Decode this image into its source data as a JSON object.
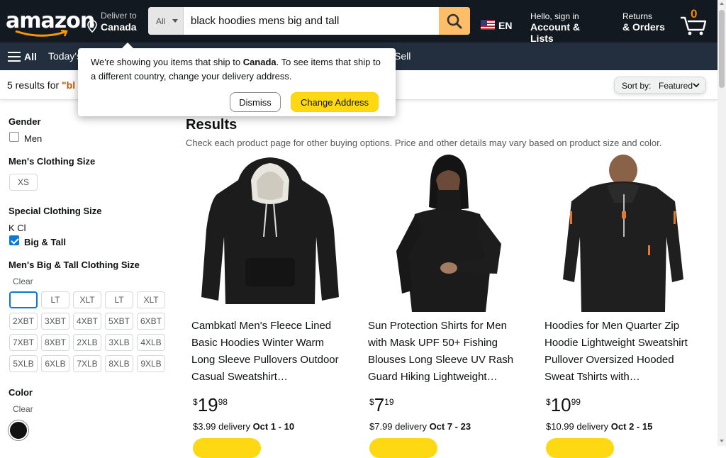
{
  "header": {
    "logo_text": "amazon",
    "deliver_line1": "Deliver to",
    "deliver_line2": "Canada",
    "search_dept": "All",
    "search_value": "black hoodies mens big and tall",
    "lang": "EN",
    "account_line1": "Hello, sign in",
    "account_line2": "Account & Lists",
    "orders_line1": "Returns",
    "orders_line2": "& Orders",
    "cart_count": "0"
  },
  "subnav": {
    "all_label": "All",
    "todays": "Today's",
    "sell": "Sell"
  },
  "popover": {
    "msg_before": "We're showing you items that ship to ",
    "msg_country": "Canada",
    "msg_after": ". To see items that ship to a different country, change your delivery address.",
    "dismiss": "Dismiss",
    "change": "Change Address"
  },
  "results_bar": {
    "count_text": "5 results for ",
    "query_text": "\"bl",
    "sort_label": "Sort by:",
    "sort_value": "Featured"
  },
  "sidebar": {
    "gender_heading": "Gender",
    "gender_option": "Men",
    "mens_size_heading": "Men's Clothing Size",
    "mens_size_option": "XS",
    "special_heading": "Special Clothing Size",
    "special_option1": "K Cl",
    "special_option2": "Big & Tall",
    "bt_heading": "Men's Big & Tall Clothing Size",
    "bt_clear": "Clear",
    "bt_sizes": [
      "",
      "LT",
      "XLT",
      "LT",
      "XLT",
      "2XBT",
      "3XBT",
      "4XBT",
      "5XBT",
      "6XBT",
      "7XBT",
      "8XBT",
      "2XLB",
      "3XLB",
      "4XLB",
      "5XLB",
      "6XLB",
      "7XLB",
      "8XLB",
      "9XLB"
    ],
    "color_heading": "Color",
    "color_clear": "Clear",
    "color_swatch": "#111111"
  },
  "main": {
    "heading": "Results",
    "sub": "Check each product page for other buying options. Price and other details may vary based on product size and color."
  },
  "products": [
    {
      "title": "Cambkatl Men's Fleece Lined Basic Hoodies Winter Warm Long Sleeve Pullovers Outdoor Casual Sweatshirt…",
      "price_whole": "19",
      "price_frac": "98",
      "ship_price": "$3.99 delivery ",
      "ship_dates": "Oct 1 - 10"
    },
    {
      "title": "Sun Protection Shirts for Men with Mask UPF 50+ Fishing Blouses Long Sleeve UV Rash Guard Hiking Lightweight…",
      "price_whole": "7",
      "price_frac": "19",
      "ship_price": "$7.99 delivery ",
      "ship_dates": "Oct 7 - 23"
    },
    {
      "title": "Hoodies for Men Quarter Zip Hoodie Lightweight Sweatshirt Pullover Oversized Hooded Sweat Tshirts with…",
      "price_whole": "10",
      "price_frac": "99",
      "ship_price": "$10.99 delivery ",
      "ship_dates": "Oct 2 - 15"
    }
  ]
}
